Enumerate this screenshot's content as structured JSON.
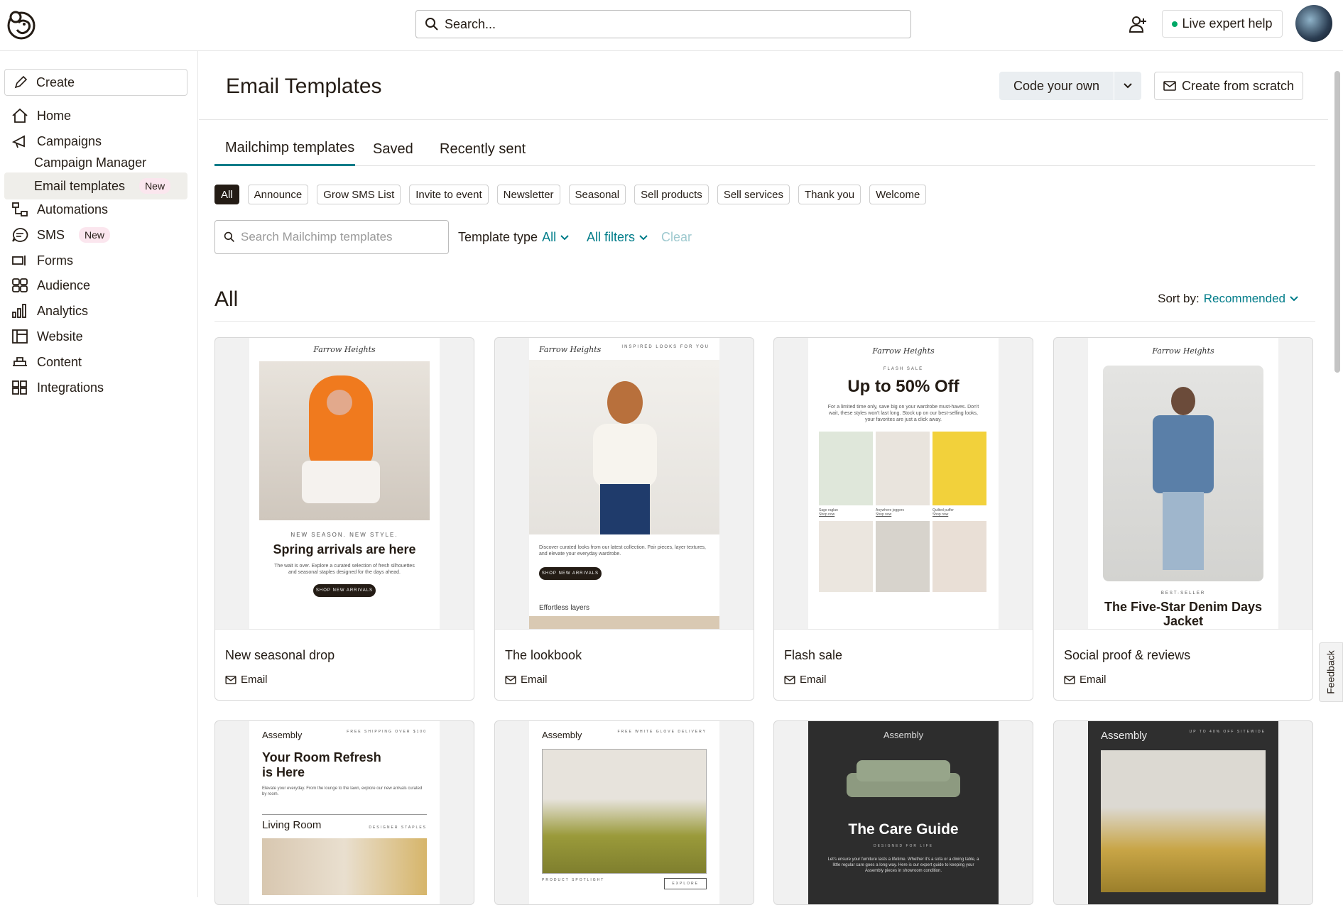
{
  "topbar": {
    "search_placeholder": "Search...",
    "live_help": "Live expert help"
  },
  "sidebar": {
    "create": "Create",
    "items": [
      {
        "label": "Home",
        "icon": "home-icon"
      },
      {
        "label": "Campaigns",
        "icon": "megaphone-icon"
      },
      {
        "label": "Campaign Manager"
      },
      {
        "label": "Email templates",
        "badge": "New"
      },
      {
        "label": "Automations",
        "icon": "flow-icon"
      },
      {
        "label": "SMS",
        "badge": "New",
        "icon": "sms-icon"
      },
      {
        "label": "Forms",
        "icon": "form-icon"
      },
      {
        "label": "Audience",
        "icon": "audience-icon"
      },
      {
        "label": "Analytics",
        "icon": "chart-icon"
      },
      {
        "label": "Website",
        "icon": "website-icon"
      },
      {
        "label": "Content",
        "icon": "content-icon"
      },
      {
        "label": "Integrations",
        "icon": "grid-icon"
      }
    ]
  },
  "header": {
    "title": "Email Templates",
    "code_own": "Code your own",
    "create_scratch": "Create from scratch"
  },
  "tabs": [
    "Mailchimp templates",
    "Saved",
    "Recently sent"
  ],
  "chips": [
    "All",
    "Announce",
    "Grow SMS List",
    "Invite to event",
    "Newsletter",
    "Seasonal",
    "Sell products",
    "Sell services",
    "Thank you",
    "Welcome"
  ],
  "filters": {
    "search_placeholder": "Search Mailchimp templates",
    "template_type_label": "Template type",
    "template_type_value": "All",
    "all_filters": "All filters",
    "clear": "Clear"
  },
  "section": {
    "title": "All",
    "sort_label": "Sort by:",
    "sort_value": "Recommended"
  },
  "cards": [
    {
      "name": "New seasonal drop",
      "type": "Email",
      "brand": "Farrow Heights",
      "kicker": "NEW SEASON. NEW STYLE.",
      "headline": "Spring arrivals are here",
      "body": "The wait is over. Explore a curated selection of fresh silhouettes and seasonal staples designed for the days ahead.",
      "cta": "SHOP NEW ARRIVALS"
    },
    {
      "name": "The lookbook",
      "type": "Email",
      "brand": "Farrow Heights",
      "kicker": "INSPIRED LOOKS FOR YOU",
      "body": "Discover curated looks from our latest collection. Pair pieces, layer textures, and elevate your everyday wardrobe.",
      "cta": "SHOP NEW ARRIVALS",
      "caption": "Effortless layers"
    },
    {
      "name": "Flash sale",
      "type": "Email",
      "brand": "Farrow Heights",
      "kicker": "FLASH SALE",
      "headline": "Up to 50% Off",
      "body": "For a limited time only, save big on your wardrobe must-haves. Don't wait, these styles won't last long. Stock up on our best-selling looks, your favorites are just a click away.",
      "products": [
        "Sage raglan",
        "Anywhere joggers",
        "Quilted puffer"
      ],
      "shop": "Shop now"
    },
    {
      "name": "Social proof & reviews",
      "type": "Email",
      "brand": "Farrow Heights",
      "kicker": "BEST-SELLER",
      "headline": "The Five-Star Denim Days Jacket"
    },
    {
      "brand": "Assembly",
      "tagline": "FREE SHIPPING OVER $100",
      "headline": "Your Room Refresh is Here",
      "body": "Elevate your everyday. From the lounge to the lawn, explore our new arrivals curated by room.",
      "section": "Living Room",
      "section_tag": "DESIGNER STAPLES"
    },
    {
      "brand": "Assembly",
      "tagline": "FREE WHITE GLOVE DELIVERY",
      "footer": "PRODUCT SPOTLIGHT",
      "cta": "EXPLORE"
    },
    {
      "brand": "Assembly",
      "headline": "The Care Guide",
      "kicker": "DESIGNED FOR LIFE",
      "body": "Let's ensure your furniture lasts a lifetime. Whether it's a sofa or a dining table, a little regular care goes a long way. Here is our expert guide to keeping your Assembly pieces in showroom condition."
    },
    {
      "brand": "Assembly",
      "tagline": "UP TO 40% OFF SITEWIDE"
    }
  ],
  "feedback": "Feedback"
}
